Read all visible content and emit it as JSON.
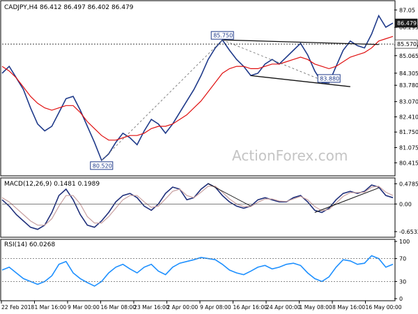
{
  "chart_data": [
    {
      "type": "line",
      "title": "CADJPY,H4  86.412 86.497 86.402 86.479",
      "xlabel": "",
      "ylabel": "",
      "x": [
        "22 Feb 2018",
        "1 Mar 16:00",
        "9 Mar 00:00",
        "16 Mar 08:00",
        "23 Mar 16:00",
        "2 Apr 00:00",
        "9 Apr 08:00",
        "16 Apr 16:00",
        "24 Apr 00:00",
        "1 May 08:00",
        "8 May 16:00",
        "16 May 00:00"
      ],
      "ylim": [
        80.0,
        87.3
      ],
      "y_ticks": [
        "87.05",
        "86.295",
        "85.535",
        "85.065",
        "84.305",
        "83.780",
        "83.070",
        "82.410",
        "81.750",
        "81.075",
        "80.415"
      ],
      "series": [
        {
          "name": "",
          "color": "#1f3a8a",
          "values": [
            84.3,
            84.6,
            84.1,
            83.6,
            82.8,
            82.1,
            81.8,
            82.0,
            82.6,
            83.2,
            83.3,
            82.7,
            82.0,
            81.3,
            80.52,
            80.8,
            81.3,
            81.7,
            81.5,
            81.2,
            81.8,
            82.3,
            82.1,
            81.7,
            82.1,
            82.6,
            83.1,
            83.6,
            84.2,
            84.9,
            85.4,
            85.75,
            85.3,
            84.9,
            84.6,
            84.2,
            84.3,
            84.7,
            84.9,
            84.7,
            85.0,
            85.3,
            85.6,
            85.1,
            84.4,
            83.9,
            83.88,
            84.6,
            85.3,
            85.7,
            85.5,
            85.4,
            86.0,
            86.8,
            86.3,
            86.479
          ]
        },
        {
          "name": "",
          "color": "#e01010",
          "values": [
            84.6,
            84.4,
            84.1,
            83.7,
            83.3,
            83.0,
            82.8,
            82.7,
            82.8,
            82.9,
            82.9,
            82.6,
            82.2,
            81.9,
            81.6,
            81.4,
            81.4,
            81.5,
            81.6,
            81.6,
            81.7,
            81.9,
            82.0,
            82.0,
            82.1,
            82.3,
            82.5,
            82.8,
            83.1,
            83.5,
            83.9,
            84.3,
            84.5,
            84.6,
            84.6,
            84.5,
            84.5,
            84.6,
            84.7,
            84.7,
            84.8,
            84.9,
            85.0,
            84.9,
            84.7,
            84.6,
            84.5,
            84.6,
            84.8,
            85.0,
            85.1,
            85.2,
            85.4,
            85.7,
            85.8,
            85.9
          ]
        }
      ],
      "annotations": [
        {
          "label": "85.750",
          "x_index": 31,
          "value": 85.75
        },
        {
          "label": "83.880",
          "x_index": 46,
          "value": 83.88
        },
        {
          "label": "80.520",
          "x_index": 14,
          "value": 80.52
        }
      ],
      "price_labels": [
        {
          "label": "86.479",
          "value": 86.479,
          "bg": "#1b1b1b",
          "fg": "#ffffff"
        },
        {
          "label": "85.570",
          "value": 85.57,
          "bg": "#ffffff",
          "fg": "#000000"
        }
      ],
      "dashed_level": 85.57,
      "watermark": "ActionForex.com"
    },
    {
      "type": "line",
      "title": "MACD(12,26,9) 0.1481 0.1989",
      "ylim": [
        -0.72,
        0.55
      ],
      "y_ticks": [
        "0.4785",
        "0.00",
        "-0.6532"
      ],
      "series": [
        {
          "name": "",
          "color": "#1f2f7a",
          "values": [
            0.1,
            -0.05,
            -0.25,
            -0.4,
            -0.55,
            -0.6,
            -0.5,
            -0.2,
            0.2,
            0.35,
            0.1,
            -0.25,
            -0.5,
            -0.55,
            -0.4,
            -0.2,
            0.05,
            0.2,
            0.25,
            0.15,
            -0.05,
            -0.15,
            0.0,
            0.25,
            0.4,
            0.35,
            0.1,
            0.15,
            0.35,
            0.48,
            0.4,
            0.2,
            0.05,
            -0.05,
            -0.1,
            -0.05,
            0.1,
            0.15,
            0.1,
            0.05,
            0.05,
            0.15,
            0.2,
            0.05,
            -0.15,
            -0.2,
            -0.1,
            0.1,
            0.25,
            0.3,
            0.25,
            0.3,
            0.45,
            0.4,
            0.2,
            0.15
          ]
        },
        {
          "name": "",
          "color": "#c8a0a0",
          "values": [
            0.15,
            0.05,
            -0.1,
            -0.25,
            -0.4,
            -0.5,
            -0.5,
            -0.35,
            -0.05,
            0.2,
            0.2,
            0.0,
            -0.3,
            -0.45,
            -0.45,
            -0.3,
            -0.1,
            0.1,
            0.2,
            0.2,
            0.05,
            -0.08,
            -0.05,
            0.12,
            0.3,
            0.35,
            0.2,
            0.15,
            0.28,
            0.42,
            0.42,
            0.28,
            0.12,
            0.0,
            -0.06,
            -0.06,
            0.04,
            0.12,
            0.12,
            0.07,
            0.06,
            0.12,
            0.18,
            0.1,
            -0.06,
            -0.16,
            -0.13,
            0.02,
            0.18,
            0.27,
            0.27,
            0.28,
            0.4,
            0.42,
            0.28,
            0.2
          ]
        }
      ]
    },
    {
      "type": "line",
      "title": "RSI(14) 60.0268",
      "ylim": [
        0,
        100
      ],
      "y_ticks": [
        "100",
        "70",
        "30",
        "0"
      ],
      "series": [
        {
          "name": "",
          "color": "#1e90ff",
          "values": [
            50,
            55,
            45,
            35,
            30,
            25,
            30,
            40,
            60,
            65,
            45,
            35,
            28,
            22,
            30,
            45,
            55,
            60,
            52,
            45,
            55,
            60,
            48,
            42,
            55,
            62,
            65,
            68,
            72,
            70,
            68,
            60,
            50,
            45,
            42,
            48,
            55,
            58,
            52,
            55,
            60,
            62,
            58,
            45,
            35,
            30,
            38,
            55,
            68,
            66,
            60,
            62,
            75,
            70,
            55,
            60
          ]
        }
      ]
    }
  ]
}
